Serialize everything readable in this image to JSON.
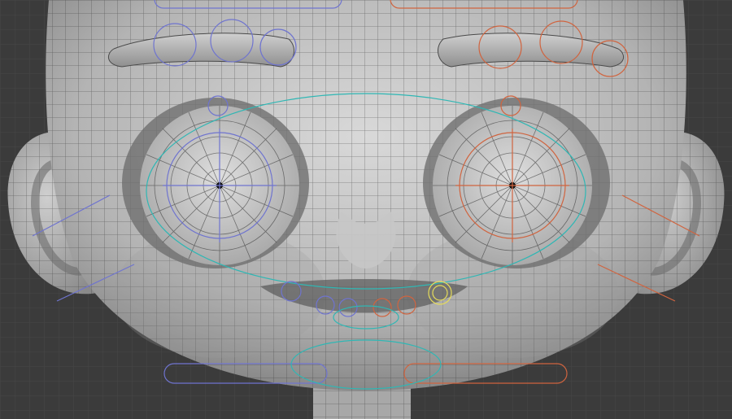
{
  "viewport": {
    "kind": "3d-viewport",
    "subject": "stylized-character-head-wireframe",
    "colors": {
      "background": "#3b3b3b",
      "grid": "#474747",
      "skin_light": "#d2d2d2",
      "skin_mid": "#a9a9a9",
      "skin_dark": "#6f6f6f",
      "wire": "#2a2a2a",
      "rig_left": "#6f74cf",
      "rig_right": "#d0643f",
      "rig_center": "#2fb7b4",
      "rig_selected": "#e6dc5a"
    }
  }
}
